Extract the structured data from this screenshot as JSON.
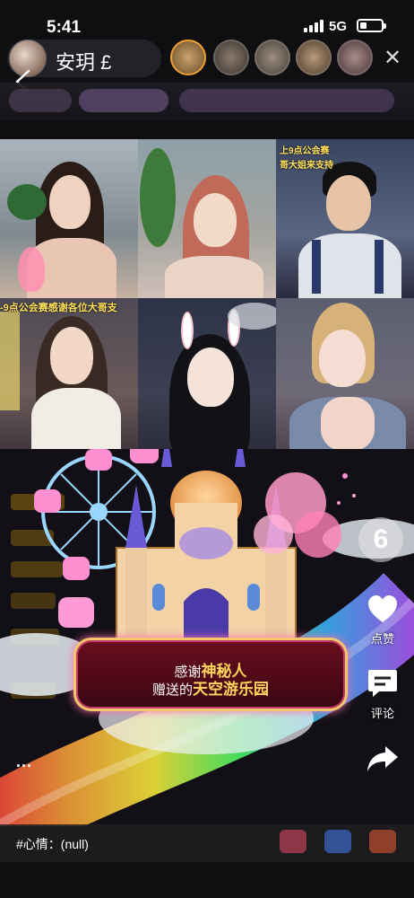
{
  "status_bar": {
    "time": "5:41",
    "network": "5G"
  },
  "header": {
    "host_name": "安玥",
    "host_badge": "£",
    "viewers": [
      {
        "name": "viewer-1",
        "color": "#c9a36b"
      },
      {
        "name": "viewer-2",
        "color": "#8a7b6e"
      },
      {
        "name": "viewer-3",
        "color": "#9c8e80"
      },
      {
        "name": "viewer-4",
        "color": "#b79a7a"
      },
      {
        "name": "viewer-5",
        "color": "#a98c8c"
      }
    ]
  },
  "grid": {
    "captions": {
      "tile3_top": "上9点公会赛",
      "tile3_second": "哥大姐来支持",
      "tile4_caption": "-9点公会赛感谢各位大哥支"
    }
  },
  "gift": {
    "thanks_prefix": "感谢",
    "sender": "神秘人",
    "sent_prefix": "赠送的",
    "gift_name": "天空游乐园"
  },
  "right_rail": {
    "six_label": "6",
    "like_label": "点赞",
    "comment_label": "评论"
  },
  "bottom": {
    "more_dots": "...",
    "mood_text": "#心情：(null)"
  },
  "colors": {
    "accent_gold": "#ffd45c",
    "gift_frame": "#f4c86a",
    "caption_yellow": "#ffe15a"
  }
}
